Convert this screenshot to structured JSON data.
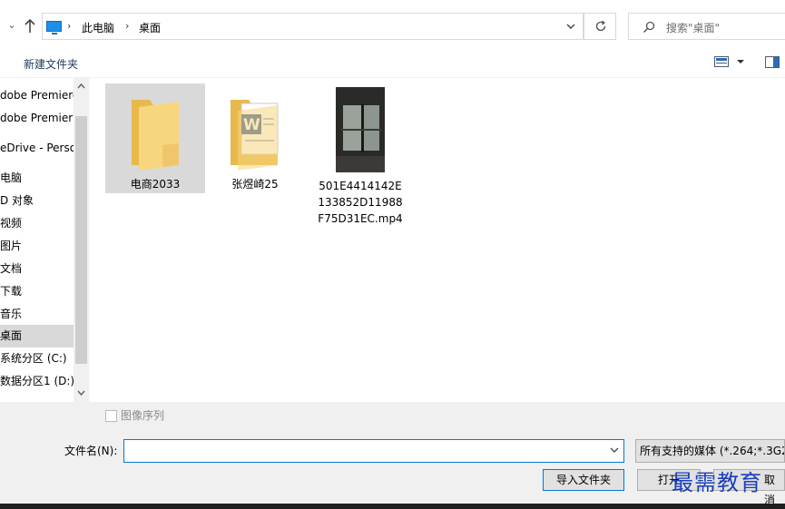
{
  "address": {
    "crumbs": [
      "此电脑",
      "桌面"
    ],
    "search_placeholder": "搜索\"桌面\""
  },
  "toolbar": {
    "new_folder_label": "新建文件夹"
  },
  "nav": {
    "items": [
      {
        "label": "dobe Premiere"
      },
      {
        "label": "dobe Premier"
      },
      {
        "label": "eDrive - Perso"
      },
      {
        "label": "电脑"
      },
      {
        "label": "D 对象"
      },
      {
        "label": "视频"
      },
      {
        "label": "图片"
      },
      {
        "label": "文档"
      },
      {
        "label": "下载"
      },
      {
        "label": "音乐"
      },
      {
        "label": "桌面"
      },
      {
        "label": "系统分区 (C:)"
      },
      {
        "label": "数据分区1 (D:)"
      }
    ]
  },
  "files": [
    {
      "label": "电商2033"
    },
    {
      "label": "张煜崎25"
    },
    {
      "label": "501E4414142E133852D11988F75D31EC.mp4"
    }
  ],
  "bottom": {
    "sequence_label": "图像序列",
    "filename_label": "文件名(N):",
    "filename_value": "",
    "filter_label": "所有支持的媒体 (*.264;*.3G2",
    "import_label": "导入文件夹",
    "open_label": "打开",
    "cancel_label": "取消"
  },
  "watermark": "最需教育"
}
